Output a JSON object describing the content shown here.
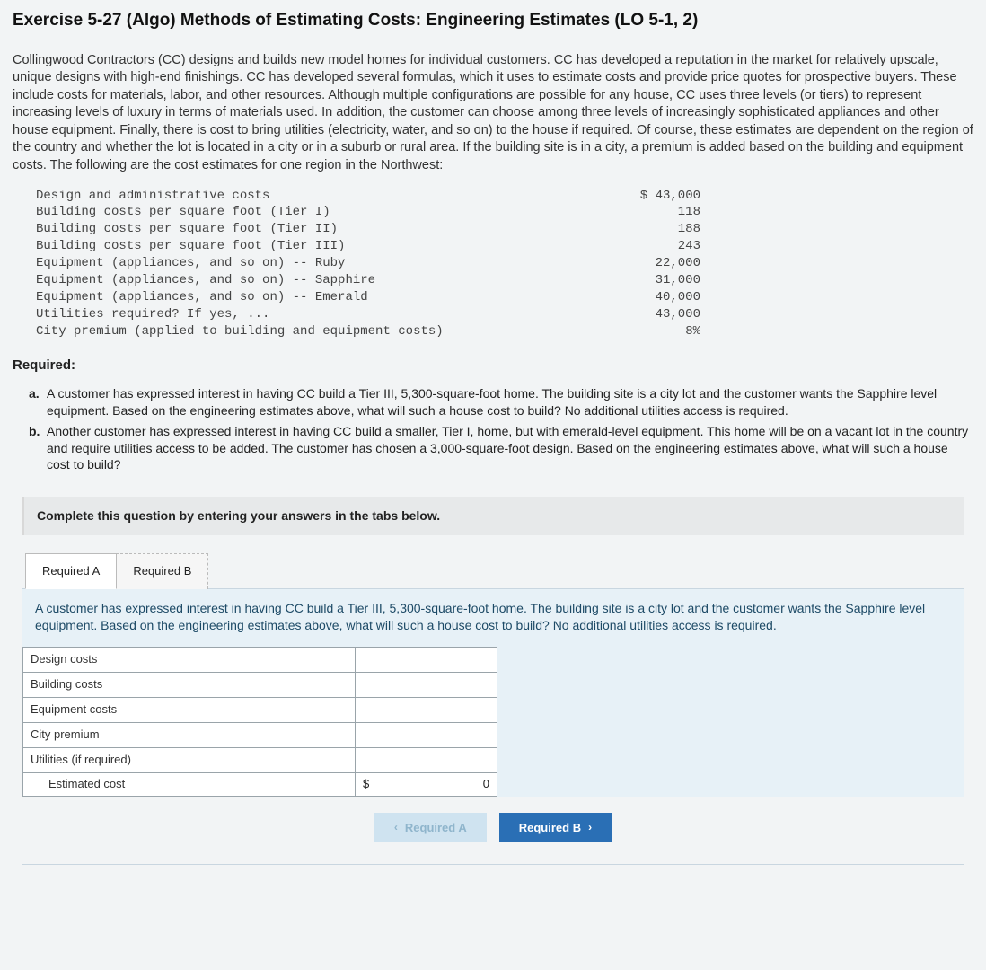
{
  "title": "Exercise 5-27 (Algo) Methods of Estimating Costs: Engineering Estimates (LO 5-1, 2)",
  "intro": "Collingwood Contractors (CC) designs and builds new model homes for individual customers. CC has developed a reputation in the market for relatively upscale, unique designs with high-end finishings. CC has developed several formulas, which it uses to estimate costs and provide price quotes for prospective buyers. These include costs for materials, labor, and other resources. Although multiple configurations are possible for any house, CC uses three levels (or tiers) to represent increasing levels of luxury in terms of materials used. In addition, the customer can choose among three levels of increasingly sophisticated appliances and other house equipment. Finally, there is cost to bring utilities (electricity, water, and so on) to the house if required. Of course, these estimates are dependent on the region of the country and whether the lot is located in a city or in a suburb or rural area. If the building site is in a city, a premium is added based on the building and equipment costs. The following are the cost estimates for one region in the Northwest:",
  "costs": [
    {
      "label": "Design and administrative costs",
      "value": "$ 43,000"
    },
    {
      "label": "Building costs per square foot (Tier I)",
      "value": "118"
    },
    {
      "label": "Building costs per square foot (Tier II)",
      "value": "188"
    },
    {
      "label": "Building costs per square foot (Tier III)",
      "value": "243"
    },
    {
      "label": "Equipment (appliances, and so on) -- Ruby",
      "value": "22,000"
    },
    {
      "label": "Equipment (appliances, and so on) -- Sapphire",
      "value": "31,000"
    },
    {
      "label": "Equipment (appliances, and so on) -- Emerald",
      "value": "40,000"
    },
    {
      "label": "Utilities required? If yes, ...",
      "value": "43,000"
    },
    {
      "label": "City premium (applied to building and equipment costs)",
      "value": "8%"
    }
  ],
  "required_heading": "Required:",
  "requirements": [
    {
      "letter": "a.",
      "text": "A customer has expressed interest in having CC build a Tier III, 5,300-square-foot home. The building site is a city lot and the customer wants the Sapphire level equipment. Based on the engineering estimates above, what will such a house cost to build? No additional utilities access is required."
    },
    {
      "letter": "b.",
      "text": "Another customer has expressed interest in having CC build a smaller, Tier I, home, but with emerald-level equipment. This home will be on a vacant lot in the country and require utilities access to be added. The customer has chosen a 3,000-square-foot design. Based on the engineering estimates above, what will such a house cost to build?"
    }
  ],
  "instruction": "Complete this question by entering your answers in the tabs below.",
  "tabs": {
    "a": "Required A",
    "b": "Required B"
  },
  "panel_text": "A customer has expressed interest in having CC build a Tier III, 5,300-square-foot home. The building site is a city lot and the customer wants the Sapphire level equipment. Based on the engineering estimates above, what will such a house cost to build? No additional utilities access is required.",
  "answer_rows": {
    "r0": "Design costs",
    "r1": "Building costs",
    "r2": "Equipment costs",
    "r3": "City premium",
    "r4": "Utilities (if required)",
    "r5": "Estimated cost"
  },
  "total": {
    "currency": "$",
    "value": "0"
  },
  "nav": {
    "prev": "Required A",
    "next": "Required B"
  }
}
